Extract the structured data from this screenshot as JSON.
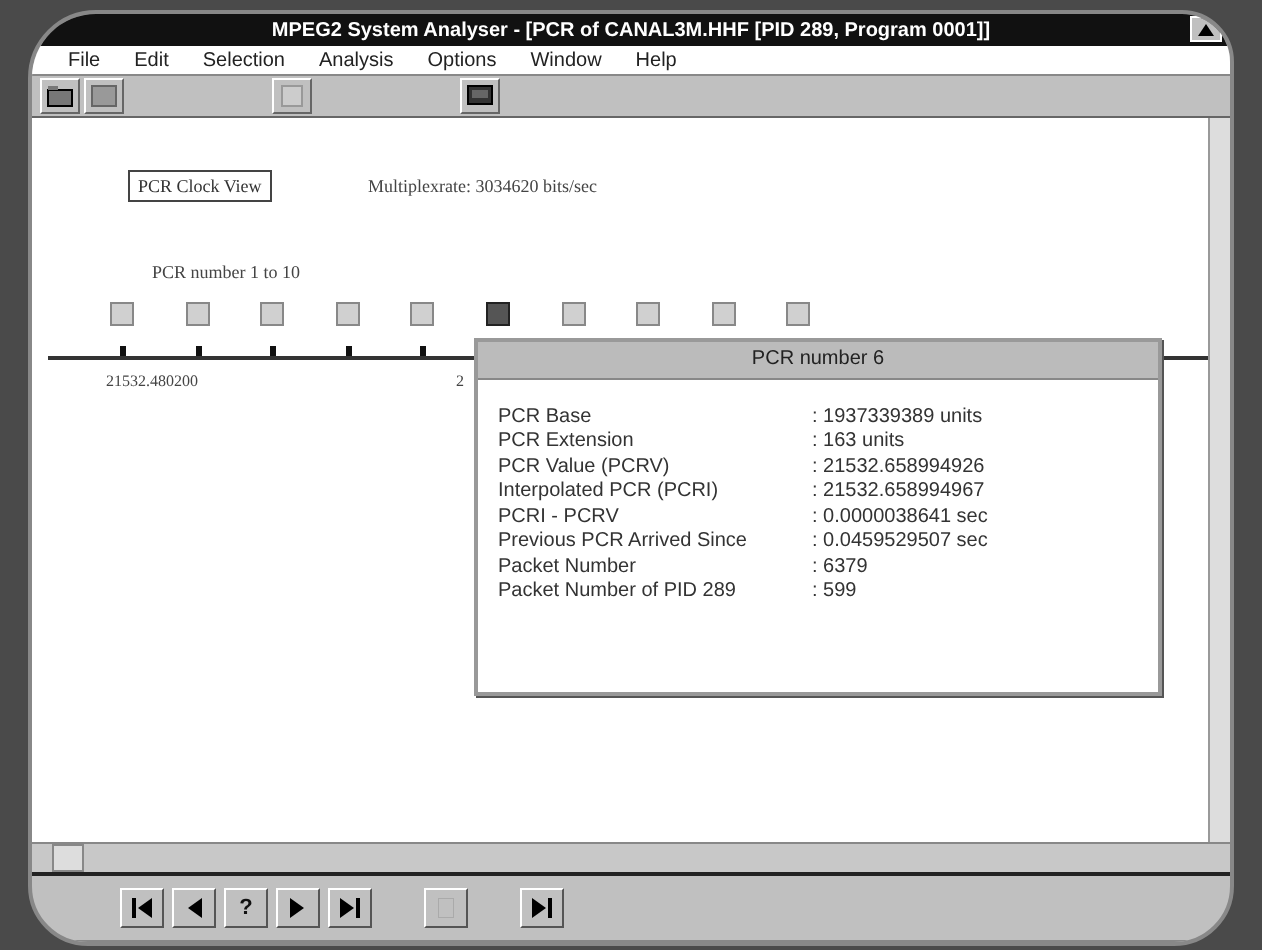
{
  "window": {
    "title": "MPEG2 System Analyser - [PCR of CANAL3M.HHF [PID 289, Program 0001]]"
  },
  "menu": [
    "File",
    "Edit",
    "Selection",
    "Analysis",
    "Options",
    "Window",
    "Help"
  ],
  "toolbar": [
    {
      "kind": "open"
    },
    {
      "kind": "save"
    },
    {
      "kind": "gap"
    },
    {
      "kind": "blank"
    },
    {
      "kind": "gap"
    },
    {
      "kind": "monitor"
    }
  ],
  "view": {
    "mode_label": "PCR Clock View",
    "multiplex_rate": "Multiplexrate: 3034620 bits/sec",
    "range_label": "PCR number 1 to 10",
    "markers": [
      {
        "selected": false,
        "time": "21532.480200"
      },
      {
        "selected": false
      },
      {
        "selected": false
      },
      {
        "selected": false
      },
      {
        "selected": false
      },
      {
        "selected": true,
        "time": "2"
      },
      {
        "selected": false
      },
      {
        "selected": false
      },
      {
        "selected": false
      },
      {
        "selected": false
      }
    ]
  },
  "popup": {
    "title": "PCR number 6",
    "rows": [
      {
        "label": "PCR Base",
        "value": ": 1937339389 units"
      },
      {
        "label": "PCR Extension",
        "value": ": 163 units"
      },
      {
        "label": "PCR Value (PCRV)",
        "value": ": 21532.658994926"
      },
      {
        "label": "Interpolated PCR (PCRI)",
        "value": ": 21532.658994967"
      },
      {
        "label": "PCRI - PCRV",
        "value": ": 0.0000038641 sec"
      },
      {
        "label": "Previous PCR Arrived Since",
        "value": ": 0.0459529507 sec"
      },
      {
        "label": "Packet Number",
        "value": ": 6379"
      },
      {
        "label": "Packet Number of PID 289",
        "value": ": 599"
      }
    ]
  },
  "nav": [
    {
      "kind": "first"
    },
    {
      "kind": "prev"
    },
    {
      "kind": "help",
      "text": "?"
    },
    {
      "kind": "next"
    },
    {
      "kind": "last"
    },
    {
      "kind": "gap"
    },
    {
      "kind": "blank"
    },
    {
      "kind": "gap"
    },
    {
      "kind": "play"
    }
  ]
}
